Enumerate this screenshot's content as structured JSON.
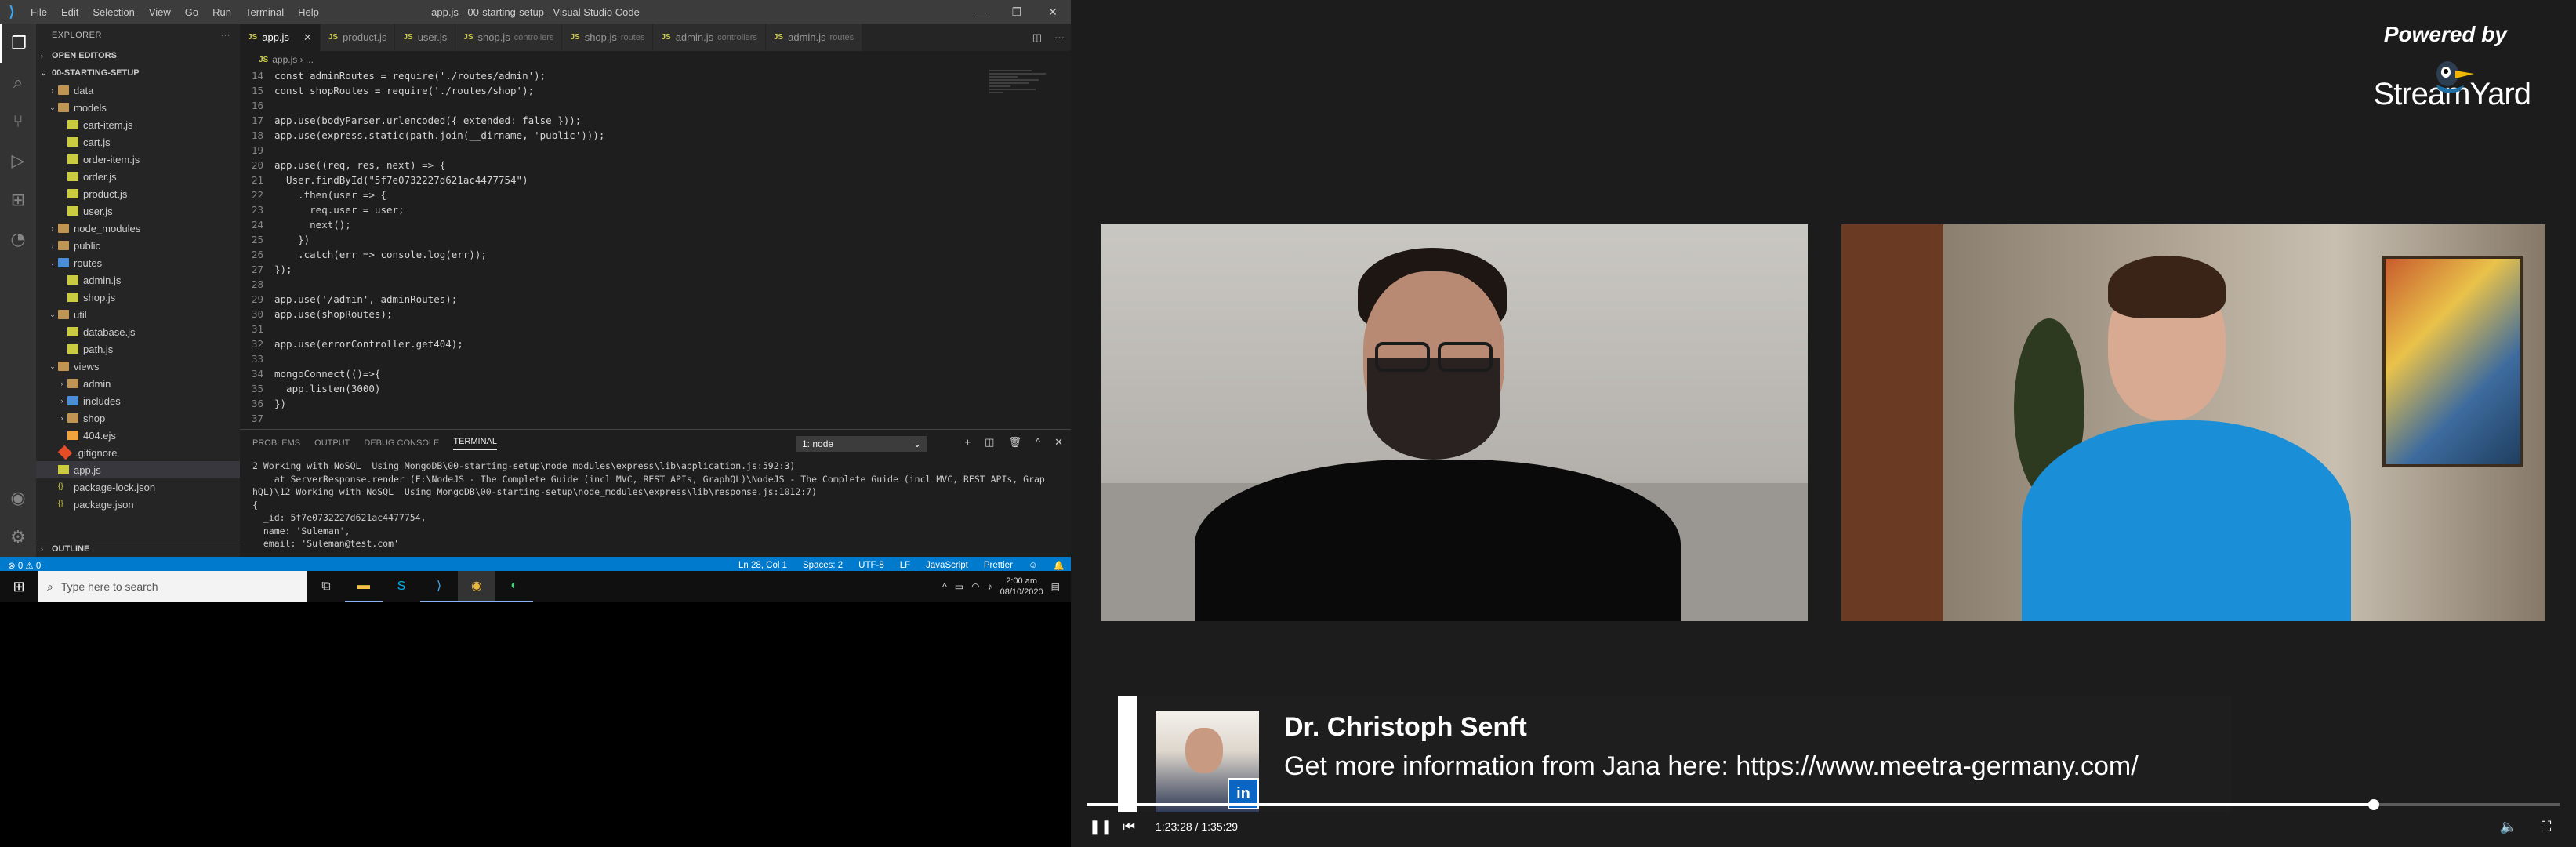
{
  "vscode": {
    "window_title": "app.js - 00-starting-setup - Visual Studio Code",
    "menu": [
      "File",
      "Edit",
      "Selection",
      "View",
      "Go",
      "Run",
      "Terminal",
      "Help"
    ],
    "explorer_label": "EXPLORER",
    "open_editors_label": "OPEN EDITORS",
    "project_label": "00-STARTING-SETUP",
    "outline_label": "OUTLINE",
    "tree": [
      {
        "label": "data",
        "kind": "folder",
        "depth": 0,
        "chev": "›"
      },
      {
        "label": "models",
        "kind": "folder",
        "depth": 0,
        "chev": "⌄"
      },
      {
        "label": "cart-item.js",
        "kind": "js",
        "depth": 1
      },
      {
        "label": "cart.js",
        "kind": "js",
        "depth": 1
      },
      {
        "label": "order-item.js",
        "kind": "js",
        "depth": 1
      },
      {
        "label": "order.js",
        "kind": "js",
        "depth": 1
      },
      {
        "label": "product.js",
        "kind": "js",
        "depth": 1
      },
      {
        "label": "user.js",
        "kind": "js",
        "depth": 1
      },
      {
        "label": "node_modules",
        "kind": "folder",
        "depth": 0,
        "chev": "›"
      },
      {
        "label": "public",
        "kind": "folder",
        "depth": 0,
        "chev": "›"
      },
      {
        "label": "routes",
        "kind": "folder-blue",
        "depth": 0,
        "chev": "⌄"
      },
      {
        "label": "admin.js",
        "kind": "js",
        "depth": 1
      },
      {
        "label": "shop.js",
        "kind": "js",
        "depth": 1
      },
      {
        "label": "util",
        "kind": "folder",
        "depth": 0,
        "chev": "⌄"
      },
      {
        "label": "database.js",
        "kind": "js",
        "depth": 1
      },
      {
        "label": "path.js",
        "kind": "js",
        "depth": 1
      },
      {
        "label": "views",
        "kind": "folder",
        "depth": 0,
        "chev": "⌄"
      },
      {
        "label": "admin",
        "kind": "folder",
        "depth": 1,
        "chev": "›"
      },
      {
        "label": "includes",
        "kind": "folder-blue",
        "depth": 1,
        "chev": "›"
      },
      {
        "label": "shop",
        "kind": "folder",
        "depth": 1,
        "chev": "›"
      },
      {
        "label": "404.ejs",
        "kind": "ejs",
        "depth": 1
      },
      {
        "label": ".gitignore",
        "kind": "git",
        "depth": 0
      },
      {
        "label": "app.js",
        "kind": "js",
        "depth": 0,
        "selected": true
      },
      {
        "label": "package-lock.json",
        "kind": "json",
        "depth": 0
      },
      {
        "label": "package.json",
        "kind": "json",
        "depth": 0
      }
    ],
    "tabs": [
      {
        "label": "app.js",
        "dir": "",
        "active": true
      },
      {
        "label": "product.js",
        "dir": "",
        "active": false
      },
      {
        "label": "user.js",
        "dir": "",
        "active": false
      },
      {
        "label": "shop.js",
        "dir": "controllers",
        "active": false
      },
      {
        "label": "shop.js",
        "dir": "routes",
        "active": false
      },
      {
        "label": "admin.js",
        "dir": "controllers",
        "active": false
      },
      {
        "label": "admin.js",
        "dir": "routes",
        "active": false
      }
    ],
    "breadcrumb": "app.js › ...",
    "code": [
      {
        "n": "14",
        "t": "const adminRoutes = require('./routes/admin');"
      },
      {
        "n": "15",
        "t": "const shopRoutes = require('./routes/shop');"
      },
      {
        "n": "16",
        "t": ""
      },
      {
        "n": "17",
        "t": "app.use(bodyParser.urlencoded({ extended: false }));"
      },
      {
        "n": "18",
        "t": "app.use(express.static(path.join(__dirname, 'public')));"
      },
      {
        "n": "19",
        "t": ""
      },
      {
        "n": "20",
        "t": "app.use((req, res, next) => {"
      },
      {
        "n": "21",
        "t": "  User.findById(\"5f7e0732227d621ac4477754\")"
      },
      {
        "n": "22",
        "t": "    .then(user => {"
      },
      {
        "n": "23",
        "t": "      req.user = user;"
      },
      {
        "n": "24",
        "t": "      next();"
      },
      {
        "n": "25",
        "t": "    })"
      },
      {
        "n": "26",
        "t": "    .catch(err => console.log(err));"
      },
      {
        "n": "27",
        "t": "});"
      },
      {
        "n": "28",
        "t": ""
      },
      {
        "n": "29",
        "t": "app.use('/admin', adminRoutes);"
      },
      {
        "n": "30",
        "t": "app.use(shopRoutes);"
      },
      {
        "n": "31",
        "t": ""
      },
      {
        "n": "32",
        "t": "app.use(errorController.get404);"
      },
      {
        "n": "33",
        "t": ""
      },
      {
        "n": "34",
        "t": "mongoConnect(()=>{"
      },
      {
        "n": "35",
        "t": "  app.listen(3000)"
      },
      {
        "n": "36",
        "t": "})"
      },
      {
        "n": "37",
        "t": ""
      }
    ],
    "panel_tabs": [
      "PROBLEMS",
      "OUTPUT",
      "DEBUG CONSOLE",
      "TERMINAL"
    ],
    "terminal_select": "1: node",
    "terminal_lines": [
      "2 Working with NoSQL  Using MongoDB\\00-starting-setup\\node_modules\\express\\lib\\application.js:592:3)",
      "    at ServerResponse.render (F:\\NodeJS - The Complete Guide (incl MVC, REST APIs, GraphQL)\\NodeJS - The Complete Guide (incl MVC, REST APIs, Grap",
      "hQL)\\12 Working with NoSQL  Using MongoDB\\00-starting-setup\\node_modules\\express\\lib\\response.js:1012:7)",
      "{",
      "  _id: 5f7e0732227d621ac4477754,",
      "  name: 'Suleman',",
      "  email: 'Suleman@test.com'"
    ],
    "status_left": "⊗ 0  ⚠ 0",
    "status_items": [
      "Ln 28, Col 1",
      "Spaces: 2",
      "UTF-8",
      "LF",
      "JavaScript",
      "Prettier"
    ]
  },
  "taskbar": {
    "search_placeholder": "Type here to search",
    "time": "2:00 am",
    "date": "08/10/2020"
  },
  "stream": {
    "powered_by": "Powered by",
    "brand": "StreamYard",
    "lower_third_name": "Dr. Christoph Senft",
    "lower_third_message": "Get more information from Jana here: https://www.meetra-germany.com/",
    "linkedin_badge": "in",
    "time_display": "1:23:28 / 1:35:29",
    "progress_fraction": 0.8735
  }
}
